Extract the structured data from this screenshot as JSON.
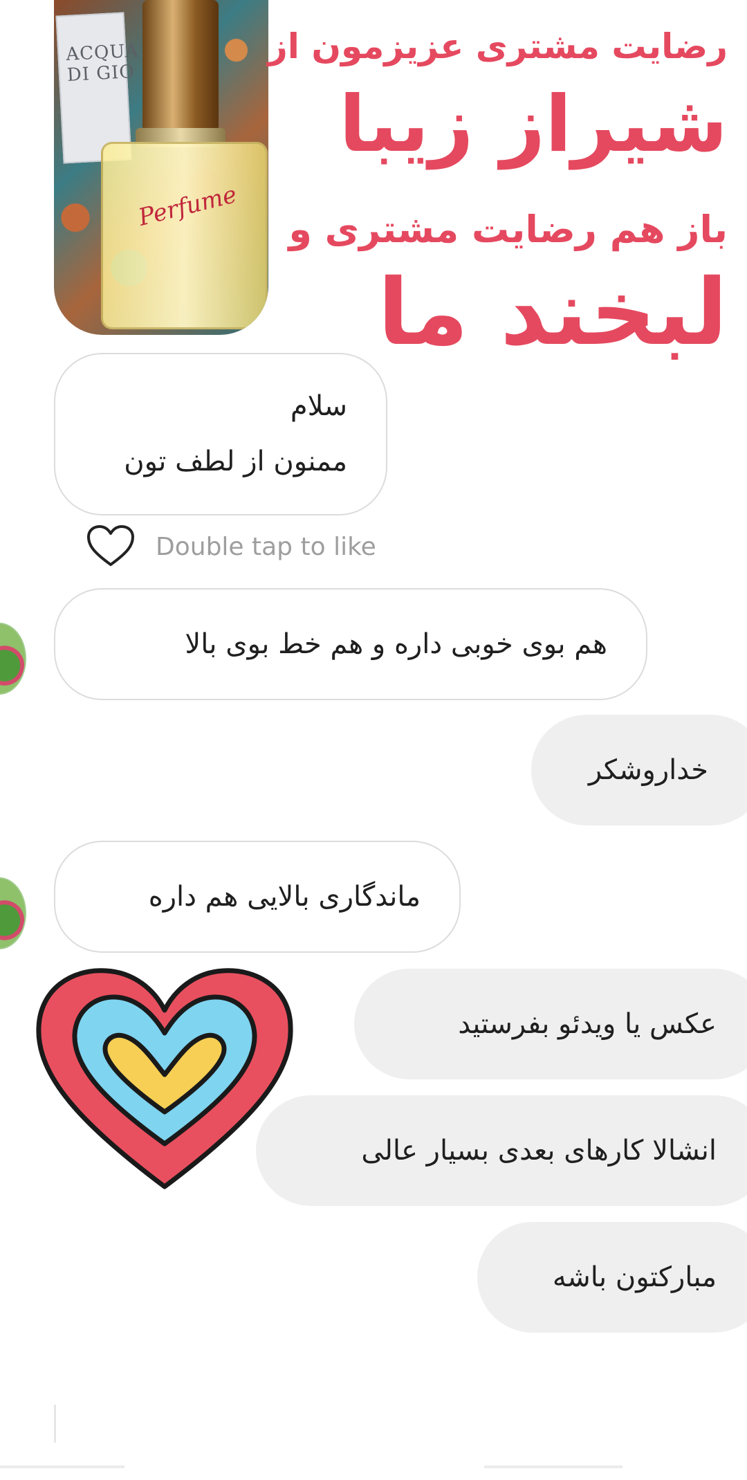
{
  "header": {
    "line1": "رضایت مشتری عزیزمون از",
    "line2": "شیراز زیبا",
    "line3": "باز هم رضایت مشتری و",
    "line4": "لبخند ما",
    "box_label": "ACQUA DI GIO",
    "bottle_label": "Perfume"
  },
  "messages": {
    "m1_line1": "سلام",
    "m1_line2": "ممنون از لطف تون",
    "like_hint": "Double tap to like",
    "m2": "هم بوی خوبی داره و هم خط بوی بالا",
    "m3": "خداروشکر",
    "m4": "ماندگاری بالایی هم داره",
    "m5": "عکس یا ویدئو بفرستید",
    "m6": "انشالا کارهای بعدی بسیار عالی",
    "m7": "مبارکتون باشه"
  },
  "colors": {
    "accent": "#e5495f",
    "incoming_bg": "#ffffff",
    "outgoing_bg": "#efefef"
  }
}
